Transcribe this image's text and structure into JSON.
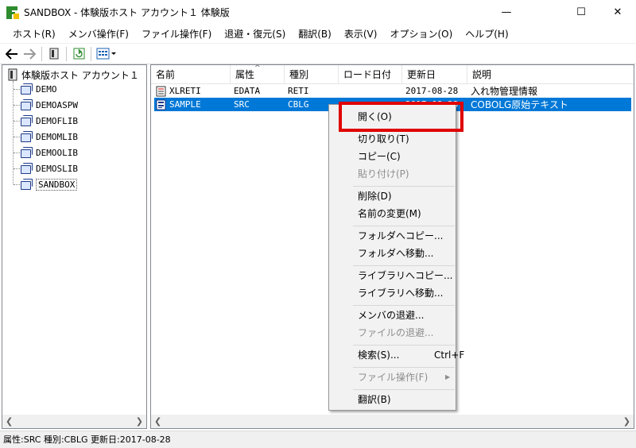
{
  "window": {
    "title": "SANDBOX - 体験版ホスト アカウント１ 体験版",
    "minimize": "—",
    "maximize": "☐",
    "close": "✕"
  },
  "menu": [
    "ホスト(R)",
    "メンバ操作(F)",
    "ファイル操作(F)",
    "退避・復元(S)",
    "翻訳(B)",
    "表示(V)",
    "オプション(O)",
    "ヘルプ(H)"
  ],
  "tree": {
    "root": "体験版ホスト アカウント１",
    "items": [
      "DEMO",
      "DEMOASPW",
      "DEMOFLIB",
      "DEMOMLIB",
      "DEMOOLIB",
      "DEMOSLIB",
      "SANDBOX"
    ],
    "selected": "SANDBOX"
  },
  "list": {
    "columns": [
      "名前",
      "属性",
      "種別",
      "ロード日付",
      "更新日",
      "説明"
    ],
    "rows": [
      {
        "name": "XLRETI",
        "attr": "EDATA",
        "kind": "RETI",
        "load": "",
        "updated": "2017-08-28",
        "desc": "入れ物管理情報"
      },
      {
        "name": "SAMPLE",
        "attr": "SRC",
        "kind": "CBLG",
        "load": "",
        "updated": "2017-08-28",
        "desc": "COBOLG原始テキスト"
      }
    ]
  },
  "context_menu": {
    "open": "開く(O)",
    "cut": "切り取り(T)",
    "copy": "コピー(C)",
    "paste": "貼り付け(P)",
    "delete": "削除(D)",
    "rename": "名前の変更(M)",
    "copy_to_folder": "フォルダへコピー...",
    "move_to_folder": "フォルダへ移動...",
    "copy_to_library": "ライブラリへコピー...",
    "move_to_library": "ライブラリへ移動...",
    "backup_member": "メンバの退避...",
    "backup_file": "ファイルの退避...",
    "search": "検索(S)...",
    "search_shortcut": "Ctrl+F",
    "file_ops": "ファイル操作(F)",
    "translate": "翻訳(B)"
  },
  "status": "属性:SRC 種別:CBLG 更新日:2017-08-28",
  "colors": {
    "selection": "#0078d7",
    "highlight": "#e00000"
  }
}
